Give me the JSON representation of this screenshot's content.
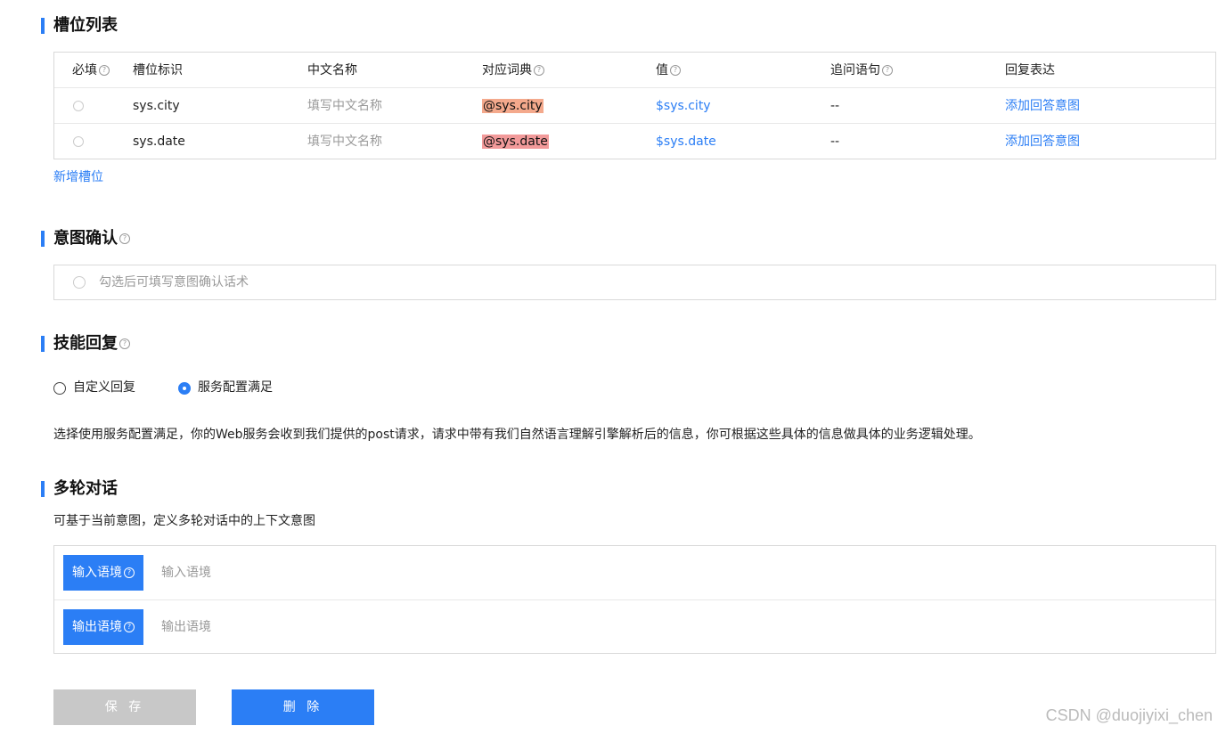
{
  "slots": {
    "title": "槽位列表",
    "headers": {
      "required": "必填",
      "slot_id": "槽位标识",
      "cn_name": "中文名称",
      "dict": "对应词典",
      "value": "值",
      "followup": "追问语句",
      "reply": "回复表达"
    },
    "rows": [
      {
        "slot_id": "sys.city",
        "cn_name_placeholder": "填写中文名称",
        "dict": "@sys.city",
        "value": "$sys.city",
        "followup": "--",
        "reply": "添加回答意图"
      },
      {
        "slot_id": "sys.date",
        "cn_name_placeholder": "填写中文名称",
        "dict": "@sys.date",
        "value": "$sys.date",
        "followup": "--",
        "reply": "添加回答意图"
      }
    ],
    "add_slot": "新增槽位"
  },
  "intent_confirm": {
    "title": "意图确认",
    "checkbox_label": "勾选后可填写意图确认话术"
  },
  "skill_reply": {
    "title": "技能回复",
    "options": [
      "自定义回复",
      "服务配置满足"
    ],
    "selected": "服务配置满足",
    "description": "选择使用服务配置满足，你的Web服务会收到我们提供的post请求，请求中带有我们自然语言理解引擎解析后的信息，你可根据这些具体的信息做具体的业务逻辑处理。"
  },
  "multi_turn": {
    "title": "多轮对话",
    "subtitle": "可基于当前意图，定义多轮对话中的上下文意图",
    "input_ctx": {
      "label": "输入语境",
      "placeholder": "输入语境"
    },
    "output_ctx": {
      "label": "输出语境",
      "placeholder": "输出语境"
    }
  },
  "actions": {
    "save": "保 存",
    "delete": "删 除"
  },
  "watermark": "CSDN @duojiyixi_chen",
  "colors": {
    "accent": "#2b7ef5",
    "dict_highlight_1": "#f4a98c",
    "dict_highlight_2": "#f29a9a",
    "disabled_button": "#c8c8c8"
  }
}
